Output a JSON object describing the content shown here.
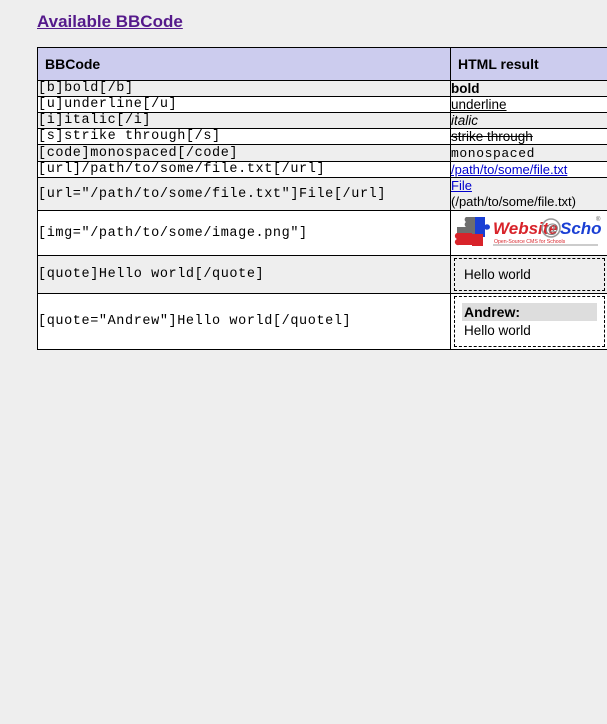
{
  "page": {
    "heading": "Available BBCode",
    "background_color": "#eeeeee",
    "heading_color": "#551a8b"
  },
  "table": {
    "header_background": "#ccccee",
    "columns": [
      "BBCode",
      "HTML result"
    ],
    "rows": [
      {
        "bbcode": "[b]bold[/b]",
        "result_kind": "bold",
        "result_text": "bold",
        "shaded": true
      },
      {
        "bbcode": "[u]underline[/u]",
        "result_kind": "underline",
        "result_text": "underline",
        "shaded": false
      },
      {
        "bbcode": "[i]italic[/i]",
        "result_kind": "italic",
        "result_text": "italic",
        "shaded": true
      },
      {
        "bbcode": "[s]strike through[/s]",
        "result_kind": "strike",
        "result_text": "strike through",
        "shaded": false
      },
      {
        "bbcode": "[code]monospaced[/code]",
        "result_kind": "mono",
        "result_text": "monospaced",
        "shaded": true
      },
      {
        "bbcode": "[url]/path/to/some/file.txt[/url]",
        "result_kind": "link",
        "result_text": "/path/to/some/file.txt",
        "link_color": "#0000cc",
        "shaded": false
      },
      {
        "bbcode": "[url=\"/path/to/some/file.txt\"]File[/url]",
        "result_kind": "link-with-target",
        "result_text": "File",
        "result_subtext": "(/path/to/some/file.txt)",
        "link_color": "#0000cc",
        "shaded": true
      },
      {
        "bbcode": "[img=\"/path/to/some/image.png\"]",
        "result_kind": "image",
        "image_alt": "Website@School",
        "image_words": [
          "Website",
          "@",
          "School"
        ],
        "image_tagline": "Open-Source CMS for Schools",
        "image_colors": {
          "website": "#d8232a",
          "at": "#808080",
          "school": "#1a3fd4",
          "puzzle_gray": "#6e6e6e",
          "puzzle_blue": "#1a3fd4",
          "puzzle_red": "#d8232a"
        },
        "shaded": false
      },
      {
        "bbcode": "[quote]Hello world[/quote]",
        "result_kind": "quote",
        "result_text": "Hello world",
        "shaded": true
      },
      {
        "bbcode": "[quote=\"Andrew\"]Hello world[/quotel]",
        "result_kind": "quote-author",
        "quote_author": "Andrew:",
        "result_text": "Hello world",
        "shaded": false
      }
    ]
  }
}
